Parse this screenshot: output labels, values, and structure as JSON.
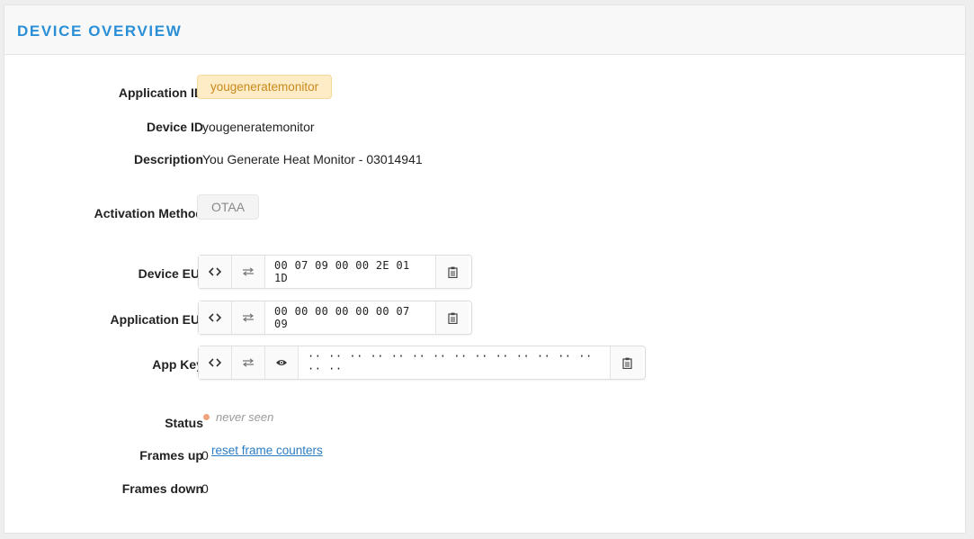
{
  "header": {
    "title": "DEVICE OVERVIEW"
  },
  "fields": {
    "application_id": {
      "label": "Application ID",
      "value": "yougeneratemonitor"
    },
    "device_id": {
      "label": "Device ID",
      "value": "yougeneratemonitor"
    },
    "description": {
      "label": "Description",
      "value": "You Generate Heat Monitor - 03014941"
    },
    "activation_method": {
      "label": "Activation Method",
      "value": "OTAA"
    },
    "device_eui": {
      "label": "Device EUI",
      "value": "00 07 09 00 00 2E 01 1D"
    },
    "application_eui": {
      "label": "Application EUI",
      "value": "00 00 00 00 00 00 07 09"
    },
    "app_key": {
      "label": "App Key",
      "value": "·· ·· ·· ·· ·· ·· ·· ·· ·· ·· ·· ·· ·· ·· ·· ··"
    },
    "status": {
      "label": "Status",
      "value": "never seen",
      "dot_color": "#f0a27a"
    },
    "frames_up": {
      "label": "Frames up",
      "value": "0",
      "action": "reset frame counters"
    },
    "frames_down": {
      "label": "Frames down",
      "value": "0"
    }
  },
  "icons": {
    "toggle_format": "code-brackets-icon",
    "swap_bytes": "swap-arrows-icon",
    "reveal": "eye-icon",
    "copy": "clipboard-icon"
  },
  "colors": {
    "title": "#2a8fd6",
    "app_tag_bg": "#fdecc6",
    "app_tag_text": "#c98a1c",
    "link": "#2a7cc4"
  }
}
